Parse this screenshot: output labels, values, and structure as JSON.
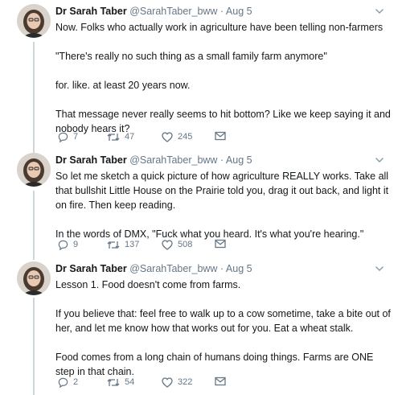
{
  "colors": {
    "text": "#14171a",
    "secondary": "#657786",
    "thread_line": "#ccd6dd"
  },
  "tweets": [
    {
      "name": "Dr Sarah Taber",
      "handle": "@SarahTaber_bww",
      "separator": "·",
      "date": "Aug 5",
      "paragraphs": [
        "Now. Folks who actually work in agriculture have been telling non-farmers",
        "\"There's really no such thing as a small family farm anymore\"",
        "for. like. at least 20 years now.",
        "That message never really seems to hit bottom? Like we keep saying it and nobody hears it?"
      ],
      "replies": "7",
      "retweets": "47",
      "likes": "245"
    },
    {
      "name": "Dr Sarah Taber",
      "handle": "@SarahTaber_bww",
      "separator": "·",
      "date": "Aug 5",
      "paragraphs": [
        "So let me sketch a quick picture of how agriculture REALLY works. Take all that bullshit Little House on the Prairie told you, drag it out back, and light it on fire. Then keep reading.",
        "In the words of DMX, \"Fuck what you heard. It's what you're hearing.\""
      ],
      "replies": "9",
      "retweets": "137",
      "likes": "508"
    },
    {
      "name": "Dr Sarah Taber",
      "handle": "@SarahTaber_bww",
      "separator": "·",
      "date": "Aug 5",
      "paragraphs": [
        "Lesson 1. Food doesn't come from farms.",
        "If you believe that: feel free to walk up to a cow sometime, take a bite out of her, and let me know how that works out for you. Eat a wheat stalk.",
        "Food comes from a long chain of humans doing things. Farms are ONE step in that chain."
      ],
      "replies": "2",
      "retweets": "54",
      "likes": "322"
    }
  ]
}
